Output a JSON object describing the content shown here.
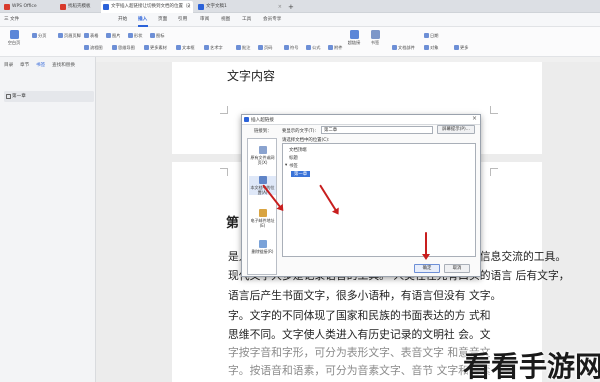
{
  "tabbar": {
    "tabs": [
      {
        "label": "WPS Office",
        "color": "#d83a2c",
        "active": false
      },
      {
        "label": "找稻壳模板",
        "color": "#d83a2c",
        "active": false
      },
      {
        "label": "文字插入超链接让切换到文档的位置（2",
        "color": "#2b62d9",
        "active": true
      },
      {
        "label": "文字文稿1",
        "color": "#2b62d9",
        "active": false
      }
    ],
    "new_tab": "+"
  },
  "menubar": {
    "items": [
      "三 文件",
      "开始",
      "插入",
      "页面",
      "引用",
      "审阅",
      "视图",
      "工具",
      "会员专享"
    ],
    "active": "插入"
  },
  "ribbon": {
    "items": [
      "空白页",
      "分页",
      "页眉页脚",
      "表格",
      "图片",
      "形状",
      "图标",
      "流程图",
      "思维导图",
      "更多素材",
      "文本框",
      "艺术字",
      "批注",
      "页码",
      "符号",
      "公式",
      "附件",
      "超链接",
      "书签",
      "文档部件",
      "日期",
      "对象",
      "更多"
    ]
  },
  "left_panel": {
    "tabs": [
      "目录",
      "章节",
      "书签",
      "查找和替换"
    ],
    "active_tab": "书签",
    "bookmark_item": "第一章"
  },
  "document": {
    "top_title": "文字内容",
    "heading": "第",
    "lines": [
      "是人类用来记录语言的符号系统。 文字和语言是人类信息交流的工具。",
      "现代文字大多是记录语言的工具。 人类往往先有口头的语言 后有文字，",
      "语言后产生书面文字，很多小语种，有语言但没有 文字。",
      "字。文字的不同体现了国家和民族的书面表达的方 式和",
      "思维不同。文字使人类进入有历史记录的文明社 会。文",
      "字按字音和字形，可分为表形文字、表音文字 和意音文",
      "字。按语音和语素，可分为音素文字、音节 文字和语素"
    ]
  },
  "dialog": {
    "title": "插入超链接",
    "display_label": "链接到：",
    "text_label": "要显示的文字(T):",
    "text_value": "第二章",
    "tooltip_button": "屏幕提示(P)...",
    "link_to": [
      "原有文件或网页(X)",
      "本文档中的位置(A)",
      "电子邮件地址(E)",
      "删除链接(R)"
    ],
    "place_label": "请选择文档中的位置(C):",
    "tree": {
      "top": "文档顶端",
      "headings": "标题",
      "bookmarks": "书签",
      "selected": "第一章"
    },
    "ok": "确定",
    "cancel": "取消"
  },
  "watermark": "看看手游网"
}
